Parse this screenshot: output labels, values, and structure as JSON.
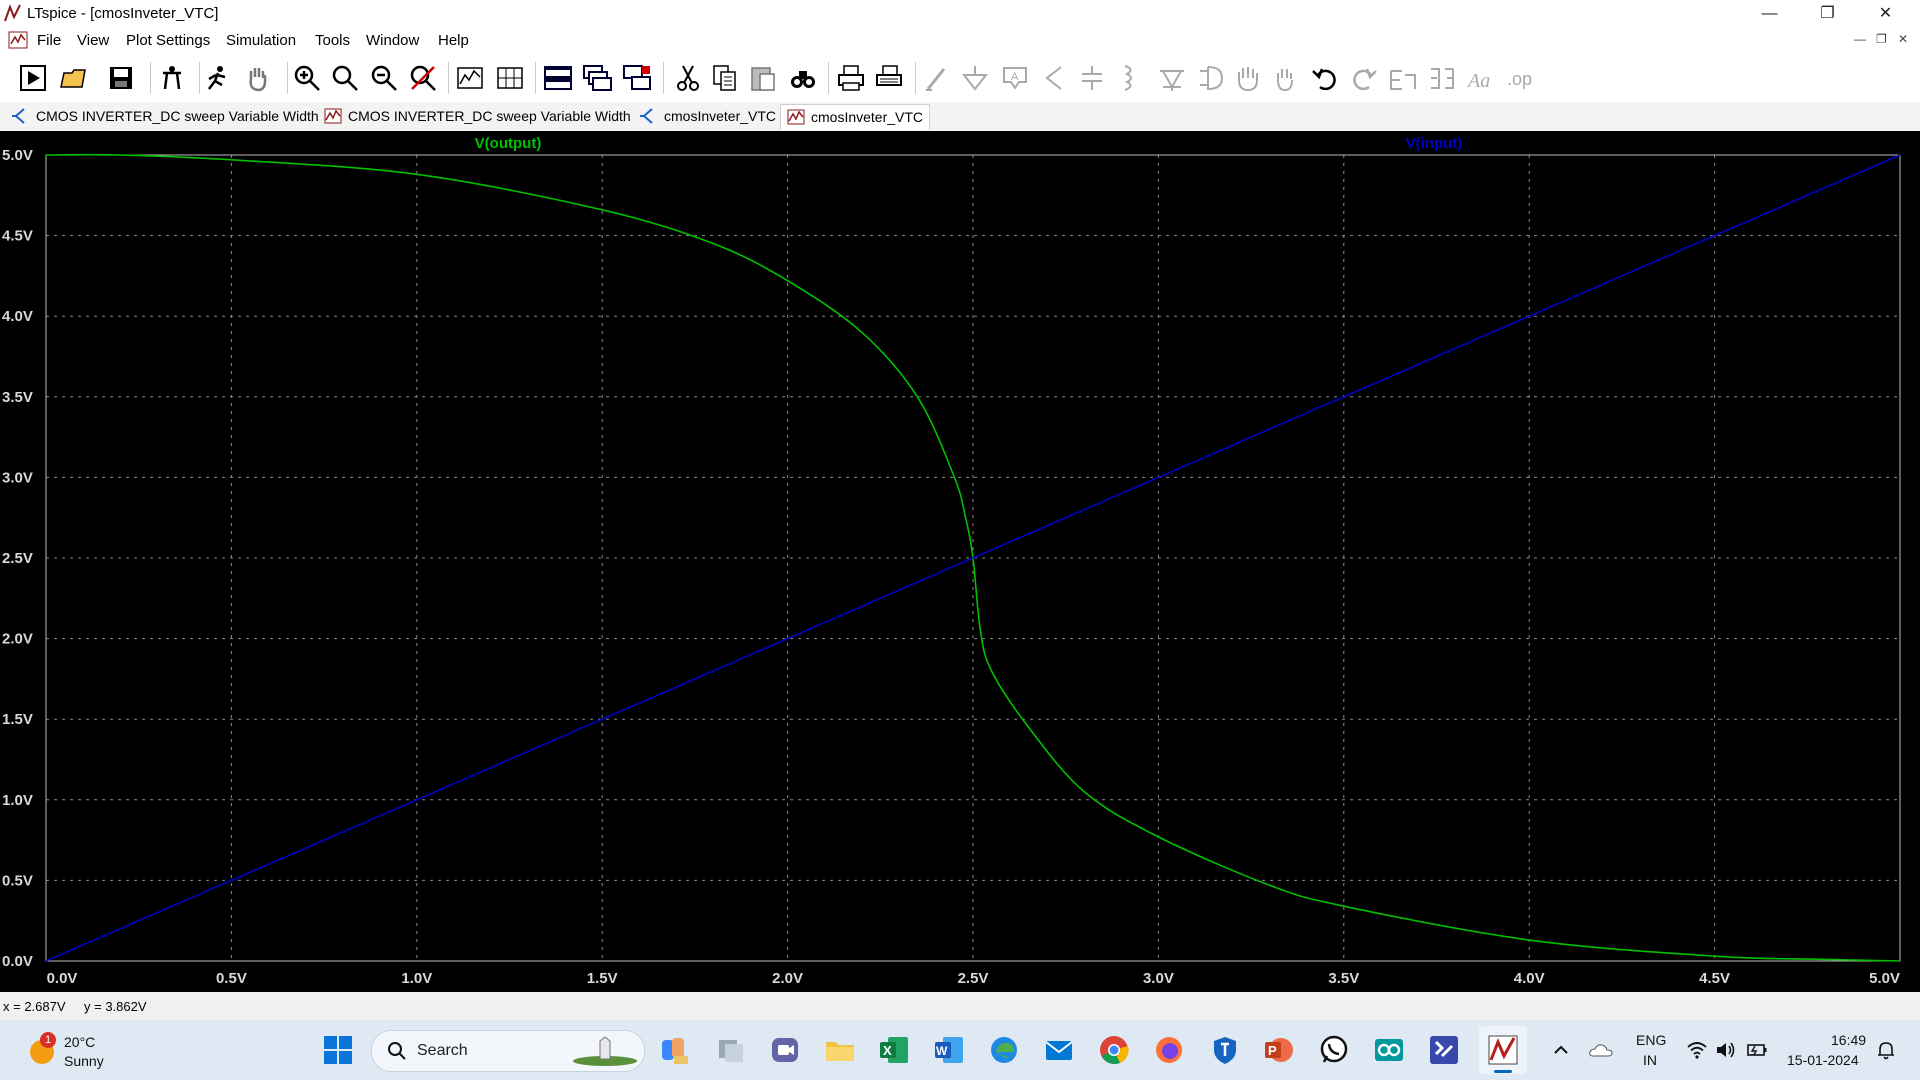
{
  "window": {
    "title": "LTspice - [cmosInveter_VTC]",
    "controls": [
      "minimize",
      "maximize",
      "close"
    ]
  },
  "menu": {
    "items": [
      "File",
      "View",
      "Plot Settings",
      "Simulation",
      "Tools",
      "Window",
      "Help"
    ]
  },
  "toolbar": {
    "icons": [
      "run-icon",
      "open-icon",
      "save-icon",
      "control-panel-icon",
      "halt-icon",
      "pan-icon",
      "zoom-in-icon",
      "zoom-full-icon",
      "zoom-out-icon",
      "zoom-cancel-icon",
      "autorange-icon",
      "grid-icon",
      "tile-horizontal-icon",
      "cascade-icon",
      "tile-vertical-icon",
      "cut-icon",
      "copy-icon",
      "paste-icon",
      "find-icon",
      "print-icon",
      "print-setup-icon",
      "wire-icon",
      "ground-icon",
      "label-icon",
      "resistor-icon",
      "capacitor-icon",
      "inductor-icon",
      "diode-icon",
      "component-icon",
      "move-icon",
      "drag-icon",
      "undo-icon",
      "redo-icon",
      "rotate-icon",
      "mirror-icon",
      "text-icon",
      "spice-directive-icon"
    ]
  },
  "tabs": [
    {
      "label": "CMOS INVERTER_DC sweep Variable Width",
      "kind": "schematic",
      "active": false
    },
    {
      "label": "CMOS INVERTER_DC sweep Variable Width",
      "kind": "waveform",
      "active": false
    },
    {
      "label": "cmosInveter_VTC",
      "kind": "schematic",
      "active": false
    },
    {
      "label": "cmosInveter_VTC",
      "kind": "waveform",
      "active": true
    }
  ],
  "chart_data": {
    "type": "line",
    "title": "",
    "xlabel": "",
    "ylabel": "",
    "xlim": [
      0,
      5
    ],
    "ylim": [
      0,
      5
    ],
    "grid": true,
    "x_ticks": [
      "0.0V",
      "0.5V",
      "1.0V",
      "1.5V",
      "2.0V",
      "2.5V",
      "3.0V",
      "3.5V",
      "4.0V",
      "4.5V",
      "5.0V"
    ],
    "y_ticks": [
      "0.0V",
      "0.5V",
      "1.0V",
      "1.5V",
      "2.0V",
      "2.5V",
      "3.0V",
      "3.5V",
      "4.0V",
      "4.5V",
      "5.0V"
    ],
    "series": [
      {
        "name": "V(output)",
        "color": "#00c000",
        "x": [
          0.0,
          0.2,
          0.5,
          1.0,
          1.5,
          1.8,
          2.0,
          2.2,
          2.35,
          2.45,
          2.48,
          2.5,
          2.52,
          2.55,
          2.65,
          2.8,
          3.0,
          3.3,
          3.5,
          4.0,
          4.5,
          4.8,
          5.0
        ],
        "y": [
          5.0,
          5.0,
          4.97,
          4.88,
          4.66,
          4.45,
          4.22,
          3.9,
          3.5,
          3.0,
          2.75,
          2.5,
          2.05,
          1.8,
          1.45,
          1.05,
          0.77,
          0.47,
          0.34,
          0.13,
          0.03,
          0.01,
          0.0
        ]
      },
      {
        "name": "V(input)",
        "color": "#0000c8",
        "x": [
          0.0,
          5.0
        ],
        "y": [
          0.0,
          5.0
        ]
      }
    ]
  },
  "status": {
    "cursor_x": "x = 2.687V",
    "cursor_y": "y = 3.862V"
  },
  "taskbar": {
    "weather_temp": "20°C",
    "weather_desc": "Sunny",
    "weather_badge": "1",
    "search_label": "Search",
    "apps": [
      "windows-start-icon",
      "copilot-icon",
      "task-view-icon",
      "teams-icon",
      "file-explorer-icon",
      "excel-icon",
      "word-icon",
      "edge-icon",
      "mail-icon",
      "chrome-icon",
      "firefox-icon",
      "defender-icon",
      "powerpoint-icon",
      "whatsapp-icon",
      "arduino-icon",
      "visual-studio-icon",
      "ltspice-icon"
    ],
    "lang_line1": "ENG",
    "lang_line2": "IN",
    "time": "16:49",
    "date": "15-01-2024"
  }
}
